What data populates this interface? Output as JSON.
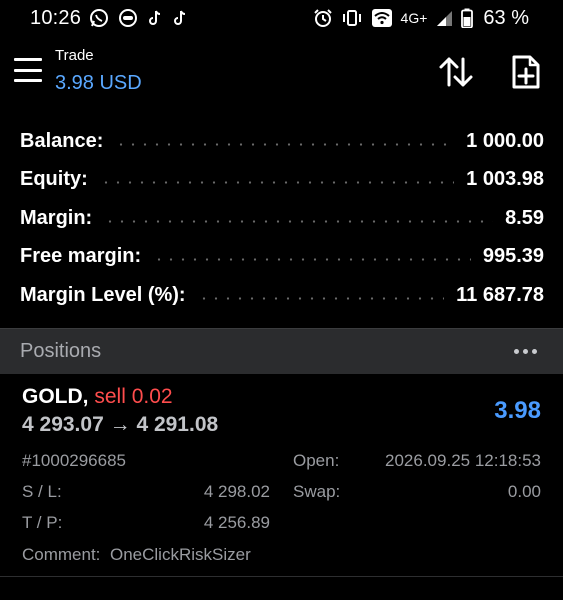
{
  "status_bar": {
    "time": "10:26",
    "network": "4G+",
    "battery": "63 %"
  },
  "header": {
    "title": "Trade",
    "subtitle": "3.98 USD"
  },
  "summary": [
    {
      "label": "Balance:",
      "value": "1 000.00"
    },
    {
      "label": "Equity:",
      "value": "1 003.98"
    },
    {
      "label": "Margin:",
      "value": "8.59"
    },
    {
      "label": "Free margin:",
      "value": "995.39"
    },
    {
      "label": "Margin Level (%):",
      "value": "11 687.78"
    }
  ],
  "positions": {
    "title": "Positions",
    "items": [
      {
        "symbol": "GOLD",
        "separator": ",",
        "side": "sell 0.02",
        "price_open": "4 293.07",
        "arrow": "→",
        "price_current": "4 291.08",
        "profit": "3.98",
        "ticket": "#1000296685",
        "open_label": "Open:",
        "open_time": "2026.09.25 12:18:53",
        "sl_label": "S / L:",
        "sl_value": "4 298.02",
        "swap_label": "Swap:",
        "swap_value": "0.00",
        "tp_label": "T / P:",
        "tp_value": "4 256.89",
        "comment_label": "Comment:",
        "comment_value": "OneClickRiskSizer"
      }
    ]
  },
  "colors": {
    "background": "#000000",
    "accent_blue": "#4a9bff",
    "sell_red": "#ff4d4d",
    "section_bg": "#2b2c2e"
  }
}
